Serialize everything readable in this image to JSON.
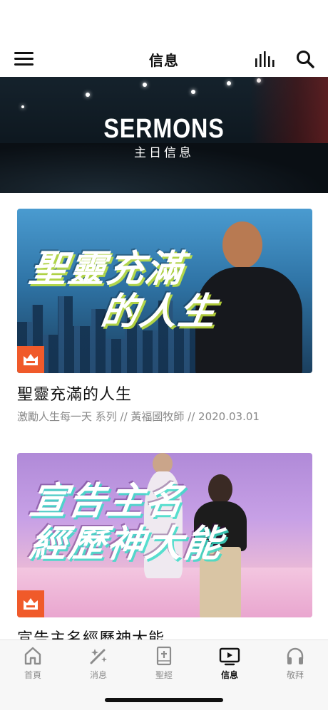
{
  "header": {
    "title": "信息"
  },
  "hero": {
    "title": "SERMONS",
    "subtitle": "主日信息"
  },
  "sermons": [
    {
      "thumb_text_line1": "聖靈充滿",
      "thumb_text_line2": "的人生",
      "title": "聖靈充滿的人生",
      "meta": "激勵人生每一天 系列  // 黃福國牧師 // 2020.03.01"
    },
    {
      "thumb_text_line1": "宣告主名",
      "thumb_text_line2": "經歷神大能",
      "title": "宣告主名經歷神大能"
    }
  ],
  "tabs": [
    {
      "label": "首頁",
      "icon": "home-icon"
    },
    {
      "label": "消息",
      "icon": "sparkle-icon"
    },
    {
      "label": "聖經",
      "icon": "bible-icon"
    },
    {
      "label": "信息",
      "icon": "tv-icon",
      "active": true
    },
    {
      "label": "敬拜",
      "icon": "headphones-icon"
    }
  ],
  "colors": {
    "badge": "#f05a2a",
    "active_tab": "#111111",
    "inactive_tab": "#8c8c8c"
  }
}
